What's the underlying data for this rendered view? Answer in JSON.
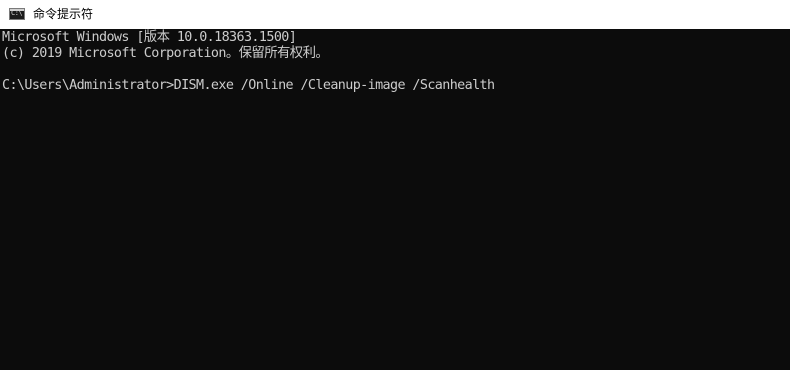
{
  "window": {
    "title": "命令提示符",
    "icon": "cmd-icon",
    "icon_glyph": "C:\\"
  },
  "console": {
    "lines": [
      "Microsoft Windows [版本 10.0.18363.1500]",
      "(c) 2019 Microsoft Corporation。保留所有权利。",
      "C:\\Users\\Administrator>DISM.exe /Online /Cleanup-image /Scanhealth"
    ],
    "background": "#0c0c0c",
    "foreground": "#cccccc"
  }
}
